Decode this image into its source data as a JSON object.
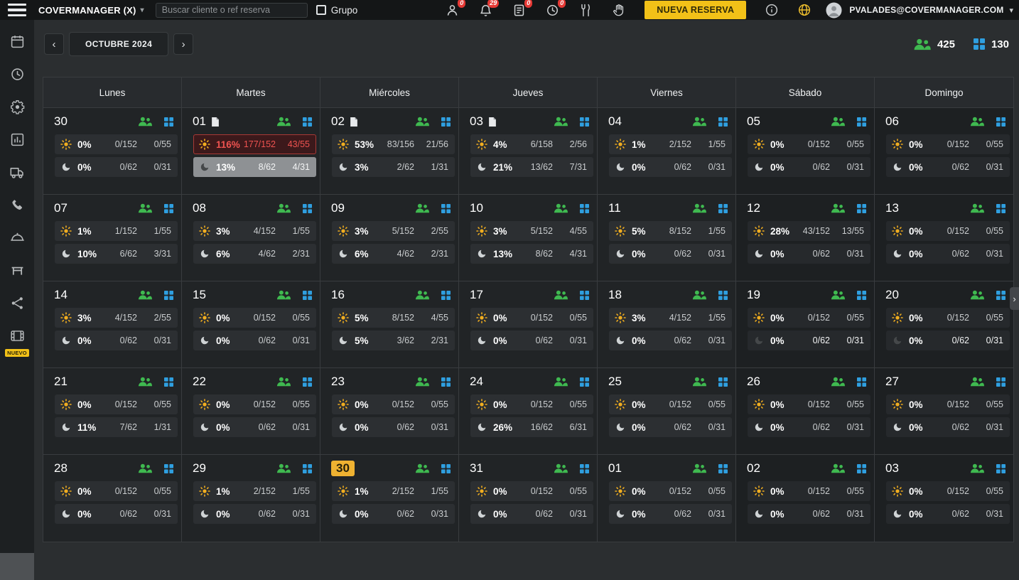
{
  "colors": {
    "accent_yellow": "#f2c118",
    "green": "#3fb950",
    "blue": "#2f9fe0",
    "red": "#ef5350",
    "gray_highlight": "#8e9194",
    "today_bg": "#efb231"
  },
  "icons": {
    "caret_down": "▾",
    "chevron_left": "‹",
    "chevron_right": "›",
    "panel_chevron": "›"
  },
  "topbar": {
    "brand": "COVERMANAGER (X)",
    "search_placeholder": "Buscar cliente o ref reserva",
    "grupo_label": "Grupo",
    "badges": [
      "0",
      "29",
      "0",
      "0"
    ],
    "nueva_reserva_label": "NUEVA RESERVA",
    "user_email": "PVALADES@COVERMANAGER.COM"
  },
  "sidebar": {
    "nuevo_badge": "NUEVO"
  },
  "nav": {
    "month_label": "OCTUBRE 2024",
    "total_people": "425",
    "total_tables": "130"
  },
  "calendar": {
    "weekdays": [
      "Lunes",
      "Martes",
      "Miércoles",
      "Jueves",
      "Viernes",
      "Sábado",
      "Domingo"
    ],
    "weeks": [
      [
        {
          "day": "30",
          "note": false,
          "today": false,
          "sun": {
            "pct": "0%",
            "a": "0/152",
            "b": "0/55",
            "hl": ""
          },
          "moon": {
            "pct": "0%",
            "a": "0/62",
            "b": "0/31",
            "hl": ""
          }
        },
        {
          "day": "01",
          "note": true,
          "today": false,
          "sun": {
            "pct": "116%",
            "a": "177/152",
            "b": "43/55",
            "hl": "red"
          },
          "moon": {
            "pct": "13%",
            "a": "8/62",
            "b": "4/31",
            "hl": "gray"
          }
        },
        {
          "day": "02",
          "note": true,
          "today": false,
          "sun": {
            "pct": "53%",
            "a": "83/156",
            "b": "21/56",
            "hl": ""
          },
          "moon": {
            "pct": "3%",
            "a": "2/62",
            "b": "1/31",
            "hl": ""
          }
        },
        {
          "day": "03",
          "note": true,
          "today": false,
          "sun": {
            "pct": "4%",
            "a": "6/158",
            "b": "2/56",
            "hl": ""
          },
          "moon": {
            "pct": "21%",
            "a": "13/62",
            "b": "7/31",
            "hl": ""
          }
        },
        {
          "day": "04",
          "note": false,
          "today": false,
          "sun": {
            "pct": "1%",
            "a": "2/152",
            "b": "1/55",
            "hl": ""
          },
          "moon": {
            "pct": "0%",
            "a": "0/62",
            "b": "0/31",
            "hl": ""
          }
        },
        {
          "day": "05",
          "note": false,
          "today": false,
          "sun": {
            "pct": "0%",
            "a": "0/152",
            "b": "0/55",
            "hl": ""
          },
          "moon": {
            "pct": "0%",
            "a": "0/62",
            "b": "0/31",
            "hl": ""
          }
        },
        {
          "day": "06",
          "note": false,
          "today": false,
          "sun": {
            "pct": "0%",
            "a": "0/152",
            "b": "0/55",
            "hl": ""
          },
          "moon": {
            "pct": "0%",
            "a": "0/62",
            "b": "0/31",
            "hl": ""
          }
        }
      ],
      [
        {
          "day": "07",
          "note": false,
          "today": false,
          "sun": {
            "pct": "1%",
            "a": "1/152",
            "b": "1/55",
            "hl": ""
          },
          "moon": {
            "pct": "10%",
            "a": "6/62",
            "b": "3/31",
            "hl": ""
          }
        },
        {
          "day": "08",
          "note": false,
          "today": false,
          "sun": {
            "pct": "3%",
            "a": "4/152",
            "b": "1/55",
            "hl": ""
          },
          "moon": {
            "pct": "6%",
            "a": "4/62",
            "b": "2/31",
            "hl": ""
          }
        },
        {
          "day": "09",
          "note": false,
          "today": false,
          "sun": {
            "pct": "3%",
            "a": "5/152",
            "b": "2/55",
            "hl": ""
          },
          "moon": {
            "pct": "6%",
            "a": "4/62",
            "b": "2/31",
            "hl": ""
          }
        },
        {
          "day": "10",
          "note": false,
          "today": false,
          "sun": {
            "pct": "3%",
            "a": "5/152",
            "b": "4/55",
            "hl": ""
          },
          "moon": {
            "pct": "13%",
            "a": "8/62",
            "b": "4/31",
            "hl": ""
          }
        },
        {
          "day": "11",
          "note": false,
          "today": false,
          "sun": {
            "pct": "5%",
            "a": "8/152",
            "b": "1/55",
            "hl": ""
          },
          "moon": {
            "pct": "0%",
            "a": "0/62",
            "b": "0/31",
            "hl": ""
          }
        },
        {
          "day": "12",
          "note": false,
          "today": false,
          "sun": {
            "pct": "28%",
            "a": "43/152",
            "b": "13/55",
            "hl": ""
          },
          "moon": {
            "pct": "0%",
            "a": "0/62",
            "b": "0/31",
            "hl": ""
          }
        },
        {
          "day": "13",
          "note": false,
          "today": false,
          "sun": {
            "pct": "0%",
            "a": "0/152",
            "b": "0/55",
            "hl": ""
          },
          "moon": {
            "pct": "0%",
            "a": "0/62",
            "b": "0/31",
            "hl": ""
          }
        }
      ],
      [
        {
          "day": "14",
          "note": false,
          "today": false,
          "sun": {
            "pct": "3%",
            "a": "4/152",
            "b": "2/55",
            "hl": ""
          },
          "moon": {
            "pct": "0%",
            "a": "0/62",
            "b": "0/31",
            "hl": ""
          }
        },
        {
          "day": "15",
          "note": false,
          "today": false,
          "sun": {
            "pct": "0%",
            "a": "0/152",
            "b": "0/55",
            "hl": ""
          },
          "moon": {
            "pct": "0%",
            "a": "0/62",
            "b": "0/31",
            "hl": ""
          }
        },
        {
          "day": "16",
          "note": false,
          "today": false,
          "sun": {
            "pct": "5%",
            "a": "8/152",
            "b": "4/55",
            "hl": ""
          },
          "moon": {
            "pct": "5%",
            "a": "3/62",
            "b": "2/31",
            "hl": ""
          }
        },
        {
          "day": "17",
          "note": false,
          "today": false,
          "sun": {
            "pct": "0%",
            "a": "0/152",
            "b": "0/55",
            "hl": ""
          },
          "moon": {
            "pct": "0%",
            "a": "0/62",
            "b": "0/31",
            "hl": ""
          }
        },
        {
          "day": "18",
          "note": false,
          "today": false,
          "sun": {
            "pct": "3%",
            "a": "4/152",
            "b": "1/55",
            "hl": ""
          },
          "moon": {
            "pct": "0%",
            "a": "0/62",
            "b": "0/31",
            "hl": ""
          }
        },
        {
          "day": "19",
          "note": false,
          "today": false,
          "sun": {
            "pct": "0%",
            "a": "0/152",
            "b": "0/55",
            "hl": ""
          },
          "moon": {
            "pct": "0%",
            "a": "0/62",
            "b": "0/31",
            "hl": "gray"
          }
        },
        {
          "day": "20",
          "note": false,
          "today": false,
          "sun": {
            "pct": "0%",
            "a": "0/152",
            "b": "0/55",
            "hl": ""
          },
          "moon": {
            "pct": "0%",
            "a": "0/62",
            "b": "0/31",
            "hl": "gray"
          }
        }
      ],
      [
        {
          "day": "21",
          "note": false,
          "today": false,
          "sun": {
            "pct": "0%",
            "a": "0/152",
            "b": "0/55",
            "hl": ""
          },
          "moon": {
            "pct": "11%",
            "a": "7/62",
            "b": "1/31",
            "hl": ""
          }
        },
        {
          "day": "22",
          "note": false,
          "today": false,
          "sun": {
            "pct": "0%",
            "a": "0/152",
            "b": "0/55",
            "hl": ""
          },
          "moon": {
            "pct": "0%",
            "a": "0/62",
            "b": "0/31",
            "hl": ""
          }
        },
        {
          "day": "23",
          "note": false,
          "today": false,
          "sun": {
            "pct": "0%",
            "a": "0/152",
            "b": "0/55",
            "hl": ""
          },
          "moon": {
            "pct": "0%",
            "a": "0/62",
            "b": "0/31",
            "hl": ""
          }
        },
        {
          "day": "24",
          "note": false,
          "today": false,
          "sun": {
            "pct": "0%",
            "a": "0/152",
            "b": "0/55",
            "hl": ""
          },
          "moon": {
            "pct": "26%",
            "a": "16/62",
            "b": "6/31",
            "hl": ""
          }
        },
        {
          "day": "25",
          "note": false,
          "today": false,
          "sun": {
            "pct": "0%",
            "a": "0/152",
            "b": "0/55",
            "hl": ""
          },
          "moon": {
            "pct": "0%",
            "a": "0/62",
            "b": "0/31",
            "hl": ""
          }
        },
        {
          "day": "26",
          "note": false,
          "today": false,
          "sun": {
            "pct": "0%",
            "a": "0/152",
            "b": "0/55",
            "hl": ""
          },
          "moon": {
            "pct": "0%",
            "a": "0/62",
            "b": "0/31",
            "hl": ""
          }
        },
        {
          "day": "27",
          "note": false,
          "today": false,
          "sun": {
            "pct": "0%",
            "a": "0/152",
            "b": "0/55",
            "hl": ""
          },
          "moon": {
            "pct": "0%",
            "a": "0/62",
            "b": "0/31",
            "hl": ""
          }
        }
      ],
      [
        {
          "day": "28",
          "note": false,
          "today": false,
          "sun": {
            "pct": "0%",
            "a": "0/152",
            "b": "0/55",
            "hl": ""
          },
          "moon": {
            "pct": "0%",
            "a": "0/62",
            "b": "0/31",
            "hl": ""
          }
        },
        {
          "day": "29",
          "note": false,
          "today": false,
          "sun": {
            "pct": "1%",
            "a": "2/152",
            "b": "1/55",
            "hl": ""
          },
          "moon": {
            "pct": "0%",
            "a": "0/62",
            "b": "0/31",
            "hl": ""
          }
        },
        {
          "day": "30",
          "note": false,
          "today": true,
          "sun": {
            "pct": "1%",
            "a": "2/152",
            "b": "1/55",
            "hl": ""
          },
          "moon": {
            "pct": "0%",
            "a": "0/62",
            "b": "0/31",
            "hl": ""
          }
        },
        {
          "day": "31",
          "note": false,
          "today": false,
          "sun": {
            "pct": "0%",
            "a": "0/152",
            "b": "0/55",
            "hl": ""
          },
          "moon": {
            "pct": "0%",
            "a": "0/62",
            "b": "0/31",
            "hl": ""
          }
        },
        {
          "day": "01",
          "note": false,
          "today": false,
          "sun": {
            "pct": "0%",
            "a": "0/152",
            "b": "0/55",
            "hl": ""
          },
          "moon": {
            "pct": "0%",
            "a": "0/62",
            "b": "0/31",
            "hl": ""
          }
        },
        {
          "day": "02",
          "note": false,
          "today": false,
          "sun": {
            "pct": "0%",
            "a": "0/152",
            "b": "0/55",
            "hl": ""
          },
          "moon": {
            "pct": "0%",
            "a": "0/62",
            "b": "0/31",
            "hl": ""
          }
        },
        {
          "day": "03",
          "note": false,
          "today": false,
          "sun": {
            "pct": "0%",
            "a": "0/152",
            "b": "0/55",
            "hl": ""
          },
          "moon": {
            "pct": "0%",
            "a": "0/62",
            "b": "0/31",
            "hl": ""
          }
        }
      ]
    ]
  }
}
